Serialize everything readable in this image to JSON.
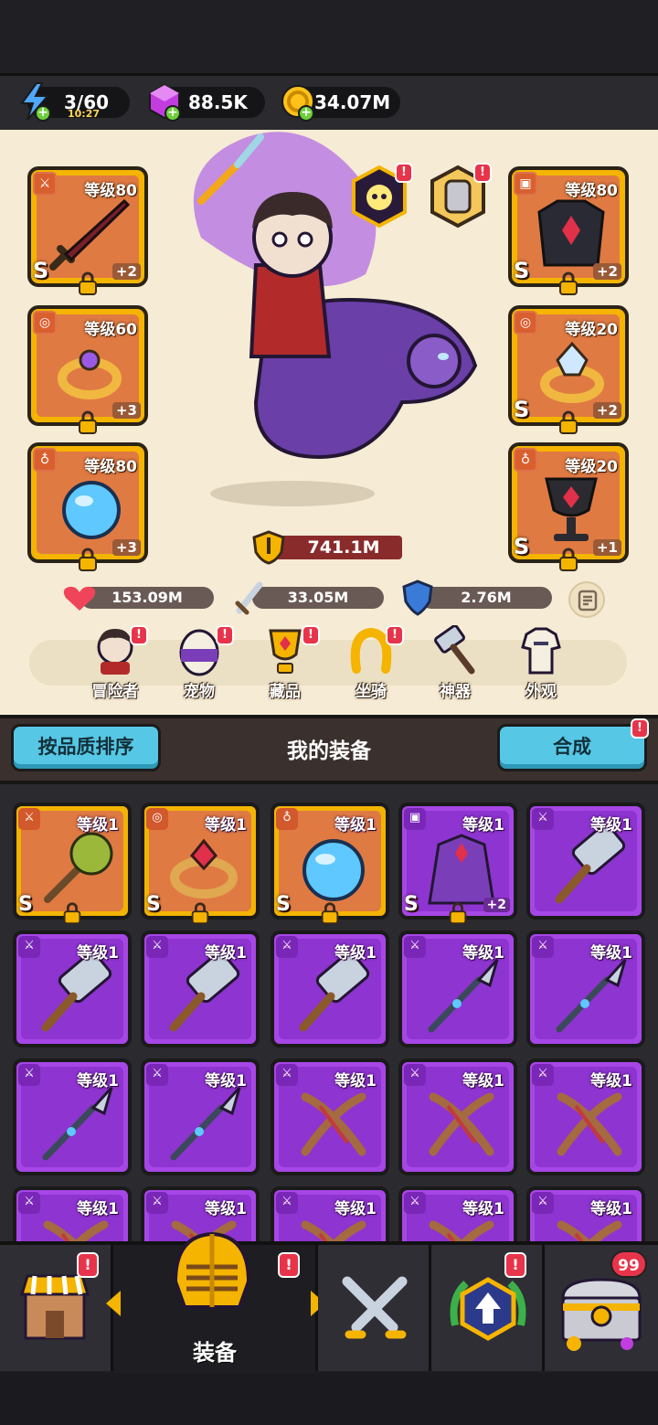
{
  "resources": {
    "energy": {
      "value": "3/60",
      "timer": "10:27",
      "icon": "lightning-icon"
    },
    "gems": {
      "value": "88.5K",
      "icon": "gem-icon"
    },
    "gold": {
      "value": "34.07M",
      "icon": "coin-icon"
    }
  },
  "hero": {
    "power": "741.1M",
    "stats": {
      "hp": "153.09M",
      "attack": "33.05M",
      "defense": "2.76M"
    },
    "slots": [
      {
        "level": "等级80",
        "grade": "S",
        "plus": "+2",
        "item": "dark-sword"
      },
      {
        "level": "等级60",
        "grade": "",
        "plus": "+3",
        "item": "gold-ring"
      },
      {
        "level": "等级80",
        "grade": "",
        "plus": "+3",
        "item": "blue-orb-necklace"
      },
      {
        "level": "等级80",
        "grade": "S",
        "plus": "+2",
        "item": "dark-armor"
      },
      {
        "level": "等级20",
        "grade": "S",
        "plus": "+2",
        "item": "crystal-ring"
      },
      {
        "level": "等级20",
        "grade": "S",
        "plus": "+1",
        "item": "black-chalice"
      }
    ],
    "menu": [
      {
        "label": "冒险者",
        "icon": "adventurer-icon"
      },
      {
        "label": "宠物",
        "icon": "pet-egg-icon"
      },
      {
        "label": "藏品",
        "icon": "collection-icon"
      },
      {
        "label": "坐骑",
        "icon": "mount-horseshoe-icon"
      },
      {
        "label": "神器",
        "icon": "artifact-hammer-icon"
      },
      {
        "label": "外观",
        "icon": "outfit-icon"
      }
    ]
  },
  "inventory": {
    "sort_label": "按品质排序",
    "title": "我的装备",
    "merge_label": "合成",
    "items": [
      {
        "level": "等级1",
        "rarity": "orange",
        "grade": "S",
        "plus": "",
        "item": "spiked-mace"
      },
      {
        "level": "等级1",
        "rarity": "orange",
        "grade": "S",
        "plus": "",
        "item": "ruby-ring"
      },
      {
        "level": "等级1",
        "rarity": "orange",
        "grade": "S",
        "plus": "",
        "item": "blue-orb"
      },
      {
        "level": "等级1",
        "rarity": "purple",
        "grade": "S",
        "plus": "+2",
        "item": "purple-cloak"
      },
      {
        "level": "等级1",
        "rarity": "purple",
        "grade": "",
        "plus": "",
        "item": "hammer"
      },
      {
        "level": "等级1",
        "rarity": "purple",
        "grade": "",
        "plus": "",
        "item": "hammer"
      },
      {
        "level": "等级1",
        "rarity": "purple",
        "grade": "",
        "plus": "",
        "item": "hammer"
      },
      {
        "level": "等级1",
        "rarity": "purple",
        "grade": "",
        "plus": "",
        "item": "hammer"
      },
      {
        "level": "等级1",
        "rarity": "purple",
        "grade": "",
        "plus": "",
        "item": "spear"
      },
      {
        "level": "等级1",
        "rarity": "purple",
        "grade": "",
        "plus": "",
        "item": "spear"
      },
      {
        "level": "等级1",
        "rarity": "purple",
        "grade": "",
        "plus": "",
        "item": "spear"
      },
      {
        "level": "等级1",
        "rarity": "purple",
        "grade": "",
        "plus": "",
        "item": "spear"
      },
      {
        "level": "等级1",
        "rarity": "purple",
        "grade": "",
        "plus": "",
        "item": "bow"
      },
      {
        "level": "等级1",
        "rarity": "purple",
        "grade": "",
        "plus": "",
        "item": "bow"
      },
      {
        "level": "等级1",
        "rarity": "purple",
        "grade": "",
        "plus": "",
        "item": "bow"
      },
      {
        "level": "等级1",
        "rarity": "purple",
        "grade": "",
        "plus": "",
        "item": "bow"
      },
      {
        "level": "等级1",
        "rarity": "purple",
        "grade": "",
        "plus": "",
        "item": "bow"
      },
      {
        "level": "等级1",
        "rarity": "purple",
        "grade": "",
        "plus": "",
        "item": "bow"
      },
      {
        "level": "等级1",
        "rarity": "purple",
        "grade": "",
        "plus": "",
        "item": "bow"
      },
      {
        "level": "等级1",
        "rarity": "purple",
        "grade": "",
        "plus": "",
        "item": "bow"
      }
    ]
  },
  "nav": {
    "active_label": "装备",
    "chest_count": "99",
    "tabs": [
      "shop-icon",
      "equipment-helmet-icon",
      "battle-swords-icon",
      "upgrade-icon",
      "treasure-chest-icon"
    ]
  },
  "colors": {
    "orange_slot": "#e07a43",
    "purple_slot": "#8e34d0",
    "gold_frame": "#f4b400",
    "accent_blue": "#56c8e6",
    "badge_red": "#e8344a"
  }
}
